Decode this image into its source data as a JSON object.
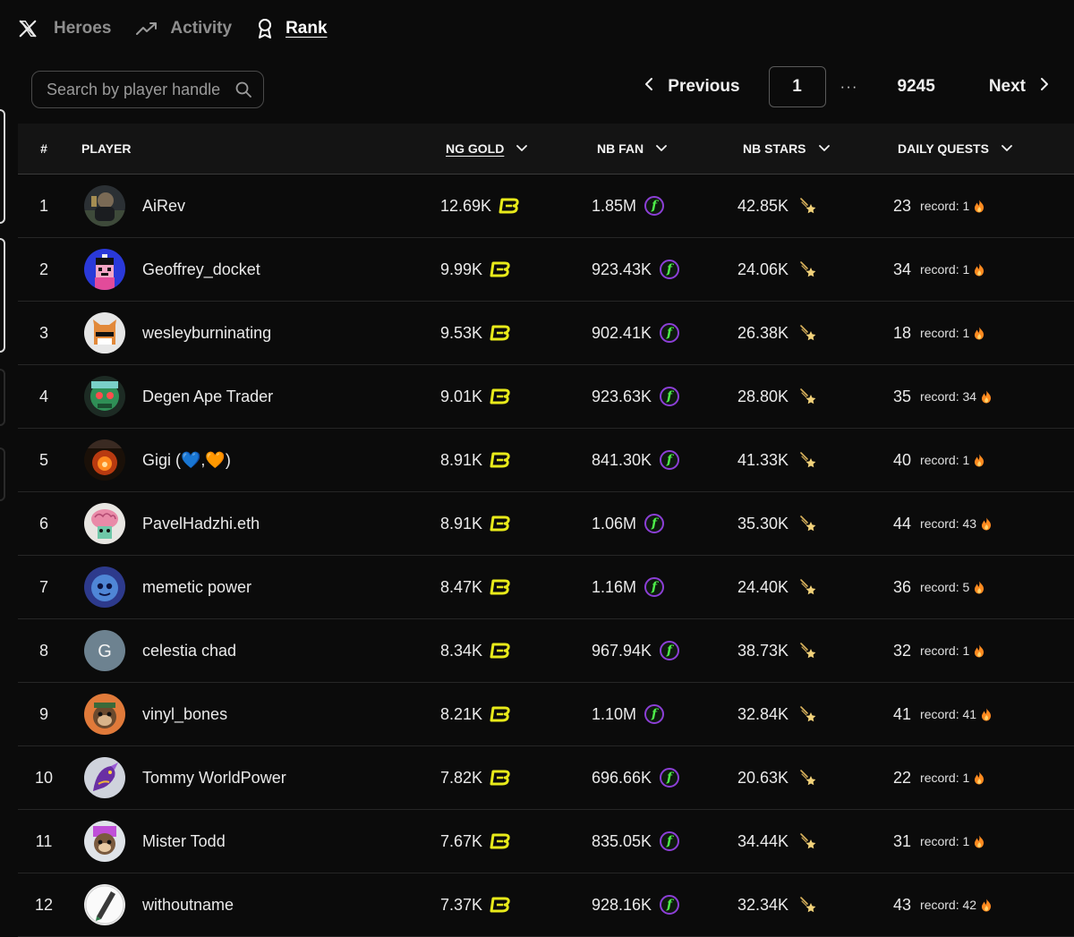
{
  "nav": {
    "items": [
      {
        "label": "Heroes"
      },
      {
        "label": "Activity"
      },
      {
        "label": "Rank"
      }
    ]
  },
  "search": {
    "placeholder": "Search by player handle"
  },
  "pagination": {
    "previous": "Previous",
    "current": "1",
    "ellipsis": "···",
    "last": "9245",
    "next": "Next"
  },
  "table": {
    "headers": {
      "rank": "#",
      "player": "PLAYER",
      "gold": "NG GOLD",
      "fan": "NB FAN",
      "stars": "NB STARS",
      "quests": "DAILY QUESTS"
    },
    "rows": [
      {
        "rank": "1",
        "name": "AiRev",
        "gold": "12.69K",
        "fan": "1.85M",
        "stars": "42.85K",
        "quests": "23",
        "record": "record: 1",
        "avatar": "photo-dark"
      },
      {
        "rank": "2",
        "name": "Geoffrey_docket",
        "gold": "9.99K",
        "fan": "923.43K",
        "stars": "24.06K",
        "quests": "34",
        "record": "record: 1",
        "avatar": "pixel-blue"
      },
      {
        "rank": "3",
        "name": "wesleyburninating",
        "gold": "9.53K",
        "fan": "902.41K",
        "stars": "26.38K",
        "quests": "18",
        "record": "record: 1",
        "avatar": "pixel-fox"
      },
      {
        "rank": "4",
        "name": "Degen Ape Trader",
        "gold": "9.01K",
        "fan": "923.63K",
        "stars": "28.80K",
        "quests": "35",
        "record": "record: 34",
        "avatar": "ape-green"
      },
      {
        "rank": "5",
        "name": "Gigi (💙,🧡)",
        "gold": "8.91K",
        "fan": "841.30K",
        "stars": "41.33K",
        "quests": "40",
        "record": "record: 1",
        "avatar": "explosion"
      },
      {
        "rank": "6",
        "name": "PavelHadzhi.eth",
        "gold": "8.91K",
        "fan": "1.06M",
        "stars": "35.30K",
        "quests": "44",
        "record": "record: 43",
        "avatar": "brain"
      },
      {
        "rank": "7",
        "name": "memetic power",
        "gold": "8.47K",
        "fan": "1.16M",
        "stars": "24.40K",
        "quests": "36",
        "record": "record: 5",
        "avatar": "blue-face"
      },
      {
        "rank": "8",
        "name": "celestia chad",
        "gold": "8.34K",
        "fan": "967.94K",
        "stars": "38.73K",
        "quests": "32",
        "record": "record: 1",
        "avatar": "letter-g",
        "initial": "G"
      },
      {
        "rank": "9",
        "name": "vinyl_bones",
        "gold": "8.21K",
        "fan": "1.10M",
        "stars": "32.84K",
        "quests": "41",
        "record": "record: 41",
        "avatar": "monkey-orange"
      },
      {
        "rank": "10",
        "name": "Tommy WorldPower",
        "gold": "7.82K",
        "fan": "696.66K",
        "stars": "20.63K",
        "quests": "22",
        "record": "record: 1",
        "avatar": "dragon"
      },
      {
        "rank": "11",
        "name": "Mister Todd",
        "gold": "7.67K",
        "fan": "835.05K",
        "stars": "34.44K",
        "quests": "31",
        "record": "record: 1",
        "avatar": "monkey-purple"
      },
      {
        "rank": "12",
        "name": "withoutname",
        "gold": "7.37K",
        "fan": "928.16K",
        "stars": "32.34K",
        "quests": "43",
        "record": "record: 42",
        "avatar": "pencil"
      }
    ]
  },
  "colors": {
    "background": "#0b0b0b",
    "header_bg": "#141414",
    "gold_icon": "#e8ea1a",
    "fan_icon_ring": "#8c3fd6",
    "fan_icon_letter": "#4ef04a",
    "flame": "#ff8a1f"
  },
  "icons": {
    "logo": "x-logo-icon",
    "activity": "trending-up-icon",
    "rank": "award-ribbon-icon",
    "search": "search-icon",
    "gold": "b-coin-icon",
    "fan": "f-token-icon",
    "stars": "shooting-star-icon",
    "record": "flame-icon"
  }
}
